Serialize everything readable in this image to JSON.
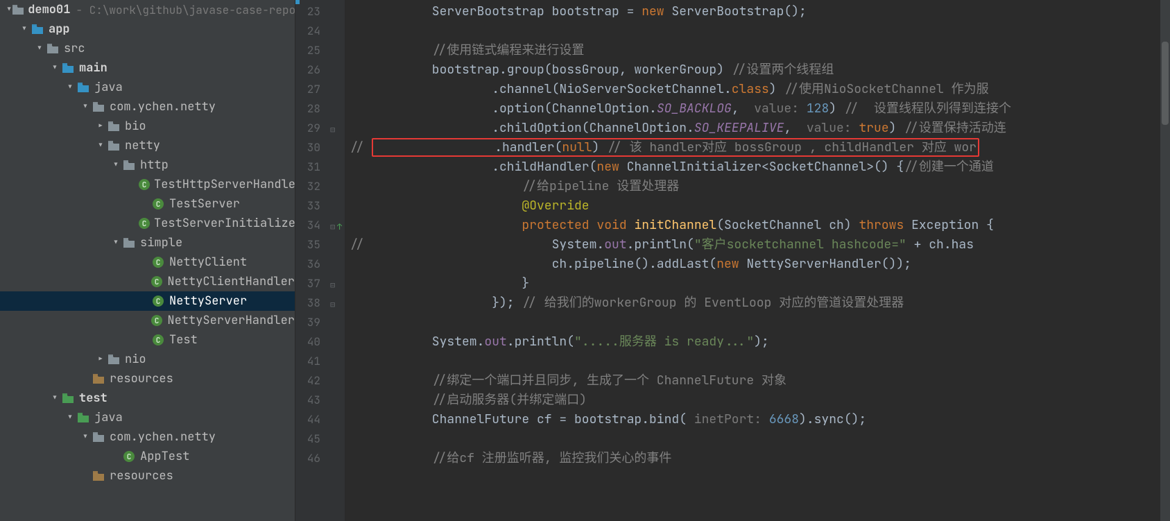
{
  "tree": {
    "project": "demo01",
    "project_hint": "- C:\\work\\github\\javase-case-repo\\nett",
    "nodes": [
      {
        "pad": 8,
        "tw": "▾",
        "ic": "folder",
        "bold": true,
        "label": "demo01",
        "hint": "- C:\\work\\github\\javase-case-repo\\nett"
      },
      {
        "pad": 26,
        "tw": "▾",
        "ic": "folder-blue",
        "bold": true,
        "label": "app"
      },
      {
        "pad": 48,
        "tw": "▾",
        "ic": "folder",
        "bold": false,
        "label": "src"
      },
      {
        "pad": 70,
        "tw": "▾",
        "ic": "folder-src",
        "bold": true,
        "label": "main"
      },
      {
        "pad": 92,
        "tw": "▾",
        "ic": "folder-blue",
        "bold": false,
        "label": "java"
      },
      {
        "pad": 114,
        "tw": "▾",
        "ic": "folder",
        "bold": false,
        "label": "com.ychen.netty"
      },
      {
        "pad": 136,
        "tw": "▸",
        "ic": "folder",
        "bold": false,
        "label": "bio"
      },
      {
        "pad": 136,
        "tw": "▾",
        "ic": "folder",
        "bold": false,
        "label": "netty"
      },
      {
        "pad": 158,
        "tw": "▾",
        "ic": "folder",
        "bold": false,
        "label": "http"
      },
      {
        "pad": 200,
        "tw": "",
        "ic": "class",
        "bold": false,
        "label": "TestHttpServerHandler"
      },
      {
        "pad": 200,
        "tw": "",
        "ic": "class",
        "bold": false,
        "label": "TestServer"
      },
      {
        "pad": 200,
        "tw": "",
        "ic": "class",
        "bold": false,
        "label": "TestServerInitializer"
      },
      {
        "pad": 158,
        "tw": "▾",
        "ic": "folder",
        "bold": false,
        "label": "simple"
      },
      {
        "pad": 200,
        "tw": "",
        "ic": "class",
        "bold": false,
        "label": "NettyClient"
      },
      {
        "pad": 200,
        "tw": "",
        "ic": "class",
        "bold": false,
        "label": "NettyClientHandler"
      },
      {
        "pad": 200,
        "tw": "",
        "ic": "class",
        "bold": false,
        "label": "NettyServer",
        "selected": true
      },
      {
        "pad": 200,
        "tw": "",
        "ic": "class",
        "bold": false,
        "label": "NettyServerHandler"
      },
      {
        "pad": 200,
        "tw": "",
        "ic": "class",
        "bold": false,
        "label": "Test"
      },
      {
        "pad": 136,
        "tw": "▸",
        "ic": "folder",
        "bold": false,
        "label": "nio"
      },
      {
        "pad": 114,
        "tw": "",
        "ic": "folder-res",
        "bold": false,
        "label": "resources"
      },
      {
        "pad": 70,
        "tw": "▾",
        "ic": "folder-test",
        "bold": true,
        "label": "test"
      },
      {
        "pad": 92,
        "tw": "▾",
        "ic": "folder-test",
        "bold": false,
        "label": "java"
      },
      {
        "pad": 114,
        "tw": "▾",
        "ic": "folder",
        "bold": false,
        "label": "com.ychen.netty"
      },
      {
        "pad": 158,
        "tw": "",
        "ic": "class",
        "bold": false,
        "label": "AppTest"
      },
      {
        "pad": 114,
        "tw": "",
        "ic": "folder-res",
        "bold": false,
        "label": "resources"
      }
    ]
  },
  "editor": {
    "first_line": 23,
    "last_line": 46,
    "lines": [
      {
        "n": 23,
        "html": "        ServerBootstrap bootstrap = <span class='kw'>new</span> ServerBootstrap();"
      },
      {
        "n": 24,
        "html": ""
      },
      {
        "n": 25,
        "html": "        <span class='cmt'>//使用链式编程来进行设置</span>"
      },
      {
        "n": 26,
        "html": "        bootstrap.group(bossGroup, workerGroup) <span class='cmt'>//设置两个线程组</span>"
      },
      {
        "n": 27,
        "html": "                .channel(NioServerSocketChannel.<span class='kw'>class</span>) <span class='cmt'>//使用NioSocketChannel 作为服</span>"
      },
      {
        "n": 28,
        "html": "                .option(ChannelOption.<span class='fld'>SO_BACKLOG</span>,  <span class='hint'>value:</span> <span class='num'>128</span>) <span class='cmt'>//  设置线程队列得到连接个</span>"
      },
      {
        "n": 29,
        "fold": true,
        "html": "                .childOption(ChannelOption.<span class='fld'>SO_KEEPALIVE</span>,  <span class='hint'>value:</span> <span class='kw'>true</span>) <span class='cmt'>//设置保持活动连</span>"
      },
      {
        "n": 30,
        "boxed": true,
        "comment": "//",
        "html": "                .handler(<span class='kw'>null</span>) <span class='cmt'>// 该 handler对应 bossGroup , childHandler 对应 wor</span>"
      },
      {
        "n": 31,
        "html": "                .childHandler(<span class='kw'>new</span> ChannelInitializer&lt;SocketChannel&gt;() {<span class='cmt'>//创建一个通道</span>"
      },
      {
        "n": 32,
        "html": "                    <span class='cmt'>//给pipeline 设置处理器</span>"
      },
      {
        "n": 33,
        "html": "                    <span class='ann'>@Override</span>"
      },
      {
        "n": 34,
        "fold": true,
        "override": true,
        "html": "                    <span class='kw'>protected</span> <span class='kw'>void</span> <span class='type' style='color:#FFC66D'>initChannel</span>(SocketChannel ch) <span class='kw'>throws</span> Exception {"
      },
      {
        "n": 35,
        "comment": "//",
        "html": "                        System.<span class='fldn'>out</span>.println(<span class='str'>\"客户socketchannel hashcode=\"</span> + ch.has"
      },
      {
        "n": 36,
        "html": "                        ch.pipeline().addLast(<span class='kw'>new</span> NettyServerHandler());"
      },
      {
        "n": 37,
        "fold": true,
        "html": "                    }"
      },
      {
        "n": 38,
        "fold": true,
        "html": "                }); <span class='cmt'>// 给我们的workerGroup 的 EventLoop 对应的管道设置处理器</span>"
      },
      {
        "n": 39,
        "html": ""
      },
      {
        "n": 40,
        "html": "        System.<span class='fldn'>out</span>.println(<span class='str'>\".....服务器 is ready...\"</span>);"
      },
      {
        "n": 41,
        "html": ""
      },
      {
        "n": 42,
        "html": "        <span class='cmt'>//绑定一个端口并且同步, 生成了一个 ChannelFuture 对象</span>"
      },
      {
        "n": 43,
        "html": "        <span class='cmt'>//启动服务器(并绑定端口)</span>"
      },
      {
        "n": 44,
        "html": "        ChannelFuture cf = bootstrap.bind( <span class='hint'>inetPort:</span> <span class='num'>6668</span>).sync();"
      },
      {
        "n": 45,
        "html": ""
      },
      {
        "n": 46,
        "html": "        <span class='cmt'>//给cf 注册监听器, 监控我们关心的事件</span>"
      }
    ]
  }
}
